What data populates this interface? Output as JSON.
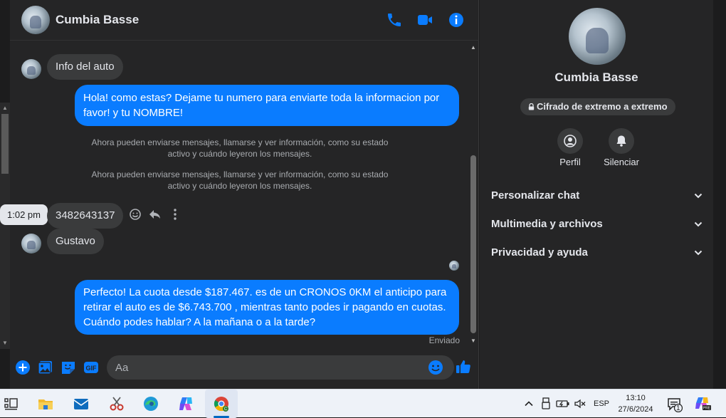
{
  "chat": {
    "contact_name": "Cumbia Basse",
    "messages": {
      "in_1": "Info del auto",
      "out_1": "Hola! como estas? Dejame tu numero para enviarte toda la informacion por favor! y tu NOMBRE!",
      "system_1": "Ahora pueden enviarse mensajes, llamarse y ver información, como su estado activo y cuándo leyeron los mensajes.",
      "system_2": "Ahora pueden enviarse mensajes, llamarse y ver información, como su estado activo y cuándo leyeron los mensajes.",
      "in_2": "3482643137",
      "in_2_time": "1:02 pm",
      "in_3": "Gustavo",
      "out_2": "Perfecto! La cuota desde $187.467. es de un CRONOS 0KM el anticipo para retirar el auto es de $6.743.700 , mientras tanto podes ir pagando en cuotas. Cuándo podes hablar? A la mañana o a la tarde?",
      "status": "Enviado"
    },
    "composer_placeholder": "Aa",
    "accent_color": "#0a7cff"
  },
  "sidebar": {
    "name": "Cumbia Basse",
    "encryption_label": "Cifrado de extremo a extremo",
    "profile_label": "Perfil",
    "mute_label": "Silenciar",
    "sections": [
      "Personalizar chat",
      "Multimedia y archivos",
      "Privacidad y ayuda"
    ]
  },
  "taskbar": {
    "language": "ESP",
    "time": "13:10",
    "date": "27/6/2024",
    "notification_count": "1"
  }
}
